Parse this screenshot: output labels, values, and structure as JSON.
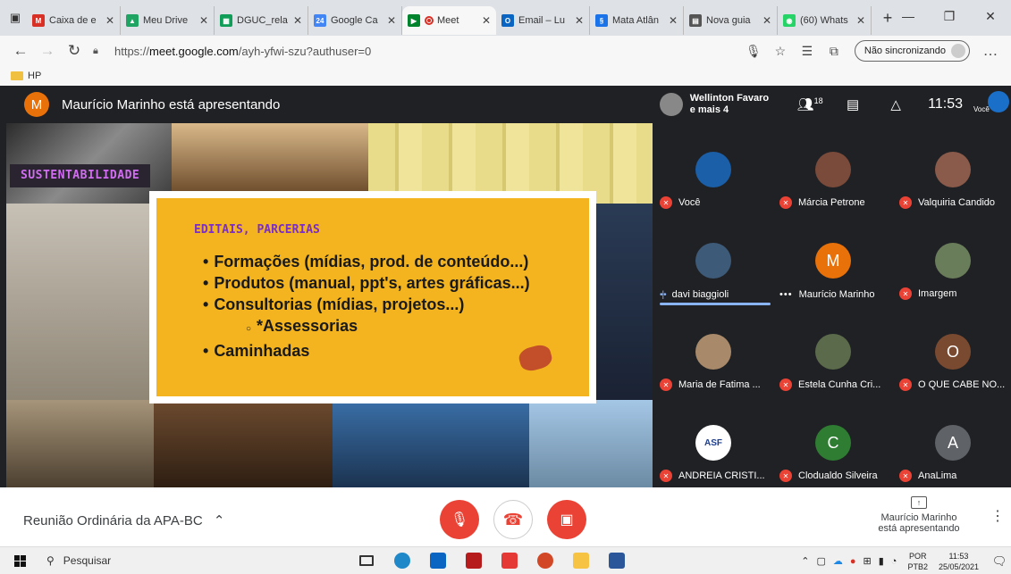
{
  "browser": {
    "tabs": [
      {
        "title": "Caixa de e",
        "icon": "gmail-icon",
        "color": "#d93025",
        "glyph": "M"
      },
      {
        "title": "Meu Drive",
        "icon": "drive-icon",
        "color": "#1fa463",
        "glyph": "▲"
      },
      {
        "title": "DGUC_rela",
        "icon": "sheets-icon",
        "color": "#0f9d58",
        "glyph": "▦"
      },
      {
        "title": "Google Ca",
        "icon": "calendar-icon",
        "color": "#4285f4",
        "glyph": "24"
      },
      {
        "title": "Meet",
        "icon": "meet-icon",
        "color": "#00832d",
        "glyph": "▶",
        "active": true,
        "recording": true
      },
      {
        "title": "Email – Lu",
        "icon": "outlook-icon",
        "color": "#0a64c2",
        "glyph": "O"
      },
      {
        "title": "Mata Atlân",
        "icon": "site-icon",
        "color": "#1a73e8",
        "glyph": "§"
      },
      {
        "title": "Nova guia",
        "icon": "new-tab-page-icon",
        "color": "#555555",
        "glyph": "▤"
      },
      {
        "title": "(60) Whats",
        "icon": "whatsapp-icon",
        "color": "#25d366",
        "glyph": "◉"
      }
    ],
    "url_prefix": "https://",
    "url_host": "meet.google.com",
    "url_path": "/ayh-yfwi-szu?authuser=0",
    "sync_label": "Não sincronizando",
    "bookmark": "HP"
  },
  "meet": {
    "presenter_initial": "M",
    "presenter_banner": "Maurício Marinho está apresentando",
    "active_speaker": "Wellinton Favaro",
    "active_speaker_more": "e mais 4",
    "participant_count": "18",
    "clock": "11:53",
    "you_label": "Você",
    "slide": {
      "tag": "SUSTENTABILIDADE",
      "heading": "EDITAIS, PARCERIAS",
      "bullets": [
        {
          "text": "Formações (mídias, prod. de conteúdo...)",
          "sub": false
        },
        {
          "text": "Produtos (manual, ppt's, artes gráficas...)",
          "sub": false
        },
        {
          "text": "Consultorias (mídias, projetos...)",
          "sub": false
        },
        {
          "text": "*Assessorias",
          "sub": true
        },
        {
          "text": "Caminhadas",
          "sub": false
        }
      ]
    },
    "participants": [
      {
        "name": "Você",
        "state": "muted",
        "avatar": "photo",
        "color": "#1a5fa8"
      },
      {
        "name": "Márcia Petrone",
        "state": "muted",
        "avatar": "photo",
        "color": "#7a4a3a"
      },
      {
        "name": "Valquiria Candido",
        "state": "muted",
        "avatar": "photo",
        "color": "#8a5a4a"
      },
      {
        "name": "davi biaggioli",
        "state": "speaking",
        "avatar": "photo",
        "color": "#3d5a78"
      },
      {
        "name": "Maurício Marinho",
        "state": "more",
        "avatar": "M",
        "color": "#e8710a"
      },
      {
        "name": "Imargem",
        "state": "muted",
        "avatar": "photo",
        "color": "#6a7d5a"
      },
      {
        "name": "Maria de Fatima ...",
        "state": "muted",
        "avatar": "photo",
        "color": "#a88a6a"
      },
      {
        "name": "Estela Cunha Cri...",
        "state": "muted",
        "avatar": "photo",
        "color": "#5a6a4a"
      },
      {
        "name": "O QUE CABE NO...",
        "state": "muted",
        "avatar": "O",
        "color": "#7a4a30"
      },
      {
        "name": "ANDREIA CRISTI...",
        "state": "muted",
        "avatar": "ASF",
        "color": "#1f3f8a"
      },
      {
        "name": "Clodualdo Silveira",
        "state": "muted",
        "avatar": "C",
        "color": "#2e7d32"
      },
      {
        "name": "AnaLima",
        "state": "muted",
        "avatar": "A",
        "color": "#5f6368"
      }
    ],
    "meeting_name": "Reunião Ordinária da APA-BC",
    "presenting_info_line1": "Maurício Marinho",
    "presenting_info_line2": "está apresentando"
  },
  "taskbar": {
    "search_placeholder": "Pesquisar",
    "lang_line1": "POR",
    "lang_line2": "PTB2",
    "time": "11:53",
    "date": "25/05/2021"
  }
}
